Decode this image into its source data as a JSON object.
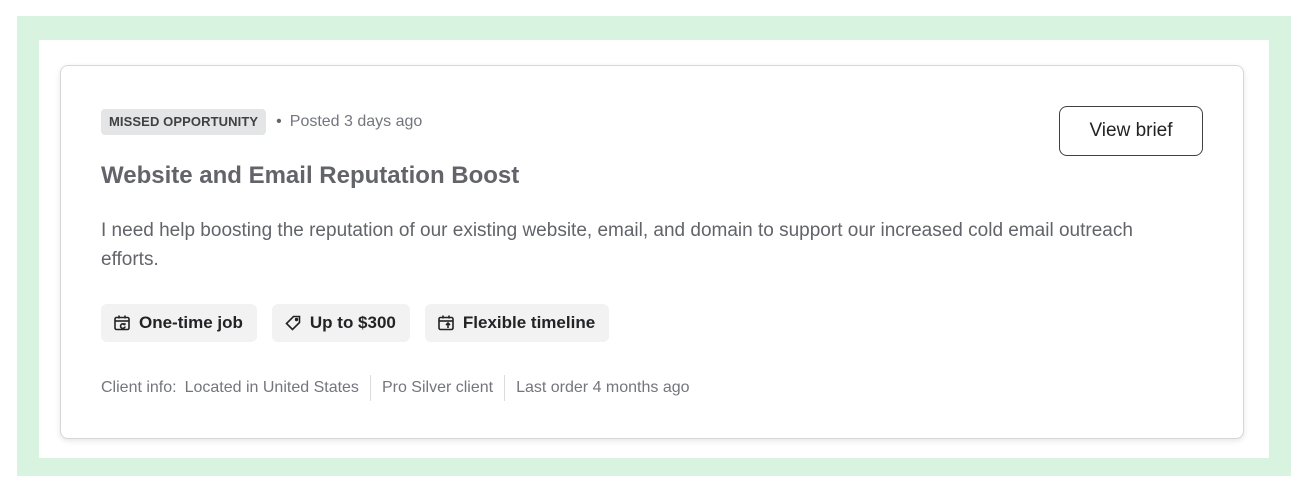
{
  "job": {
    "badge": "MISSED OPPORTUNITY",
    "dot": "•",
    "posted": "Posted 3 days ago",
    "view_brief_label": "View brief",
    "title": "Website and Email Reputation Boost",
    "description": "I need help boosting the reputation of our existing website, email, and domain to support our increased cold email outreach efforts.",
    "tags": [
      {
        "icon": "calendar-repeat-icon",
        "label": "One-time job"
      },
      {
        "icon": "price-tag-icon",
        "label": "Up to $300"
      },
      {
        "icon": "calendar-flex-icon",
        "label": "Flexible timeline"
      }
    ],
    "client": {
      "label": "Client info:",
      "location": "Located in United States",
      "tier": "Pro Silver client",
      "last_order": "Last order 4 months ago"
    }
  },
  "colors": {
    "frame_bg": "#d8f3e0",
    "badge_bg": "#e4e5e7",
    "tag_bg": "#f2f2f3",
    "title_text": "#62646a"
  }
}
